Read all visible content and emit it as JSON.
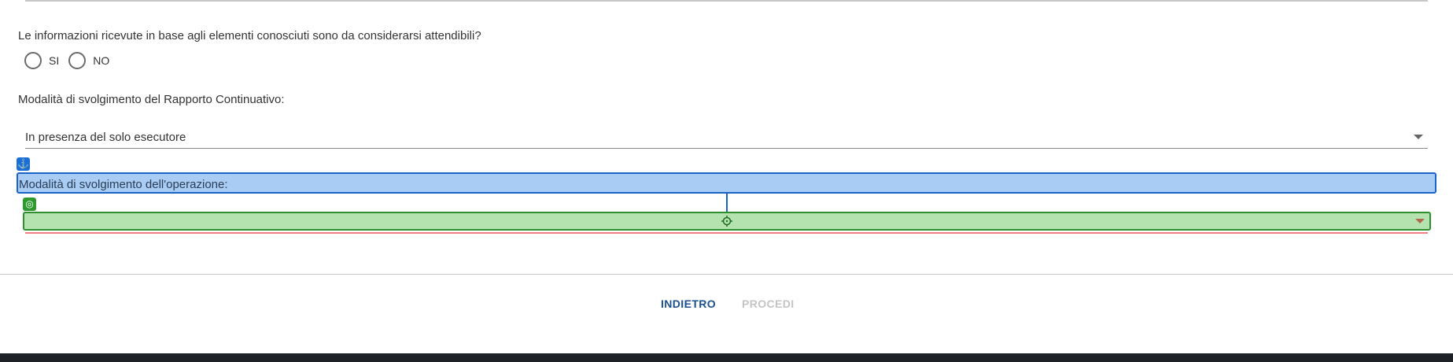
{
  "form": {
    "question_reliability": "Le informazioni ricevute in base agli elementi conosciuti sono da considerarsi attendibili?",
    "radio_options": [
      {
        "label": "SI",
        "selected": false
      },
      {
        "label": "NO",
        "selected": false
      }
    ],
    "rapporto_label": "Modalità di svolgimento del Rapporto Continuativo:",
    "rapporto_value": "In presenza del solo esecutore",
    "operazione_label": "Modalità di svolgimento dell'operazione:",
    "operazione_value": ""
  },
  "overlay": {
    "anchor_icon": "anchor-icon",
    "target_icon": "target-icon",
    "label_color": "#a9ccf5",
    "target_color": "#b5e3b0"
  },
  "footer": {
    "back_label": "INDIETRO",
    "next_label": "PROCEDI",
    "next_disabled": true
  },
  "colors": {
    "accent": "#1a4f8f",
    "error": "#f08080",
    "disabled": "#c4c4c4"
  }
}
